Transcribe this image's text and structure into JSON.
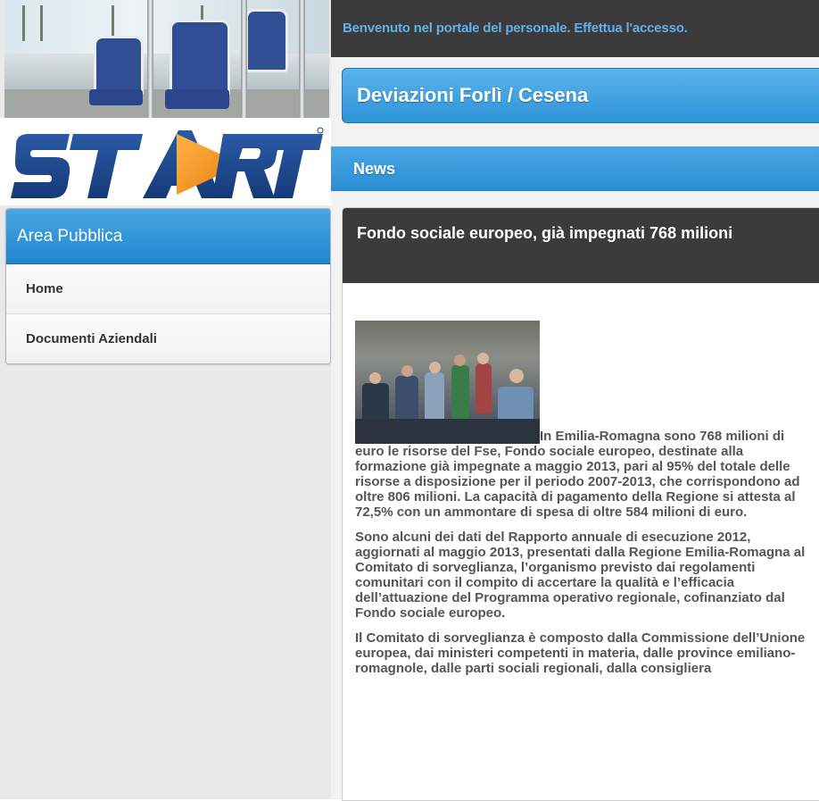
{
  "header": {
    "welcome_text": "Benvenuto nel portale del personale. Effettua l'accesso."
  },
  "logo": {
    "text": "START",
    "colors": {
      "navy": "#1a3f80",
      "orange": "#f39c12"
    }
  },
  "sidebar": {
    "title": "Area Pubblica",
    "items": [
      {
        "label": "Home"
      },
      {
        "label": "Documenti Aziendali"
      }
    ]
  },
  "main": {
    "deviation_button": "Deviazioni Forlì / Cesena",
    "news_title": "News",
    "article": {
      "title": "Fondo sociale europeo, già impegnati 768 milioni",
      "paragraphs": [
        "In Emilia-Romagna sono 768 milioni di euro le risorse del Fse, Fondo sociale europeo, destinate alla formazione già impegnate a maggio 2013, pari al 95% del totale delle risorse a disposizione per il periodo 2007-2013, che corrispondono ad oltre 806 milioni. La capacità di pagamento della Regione si attesta al 72,5% con un ammontare di spesa di oltre 584 milioni di euro.",
        "Sono alcuni dei dati del Rapporto annuale di esecuzione 2012, aggiornati al maggio 2013, presentati dalla Regione Emilia-Romagna al Comitato di sorveglianza, l’organismo previsto dai regolamenti comunitari con il compito di accertare la qualità e l’efficacia dell’attuazione del Programma operativo regionale, cofinanziato dal Fondo sociale europeo.",
        "Il Comitato di sorveglianza è composto dalla Commissione dell’Unione europea, dai ministeri competenti in materia, dalle province emiliano-romagnole, dalle parti sociali regionali, dalla consigliera"
      ]
    }
  },
  "colors": {
    "accent_blue": "#2e93d8",
    "dark_bar": "#3b3b3b",
    "welcome_text": "#62b0ea"
  }
}
